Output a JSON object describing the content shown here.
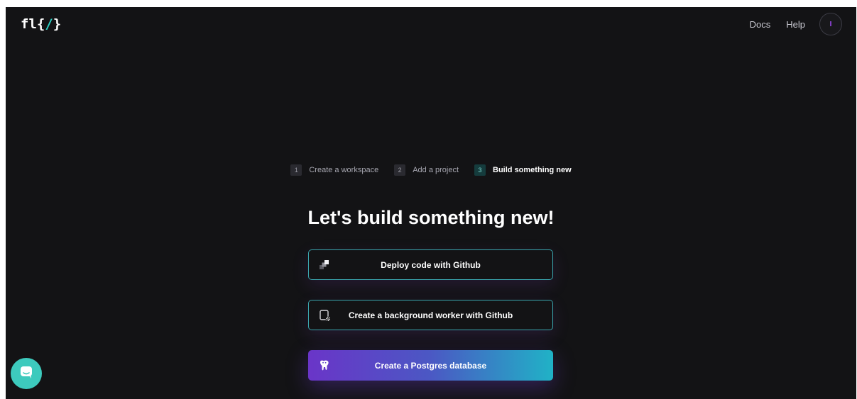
{
  "header": {
    "logo_left": "fl{",
    "logo_slash": "/",
    "logo_right": "}",
    "docs_label": "Docs",
    "help_label": "Help",
    "avatar_initial": "I"
  },
  "steps": [
    {
      "number": "1",
      "label": "Create a workspace",
      "active": false
    },
    {
      "number": "2",
      "label": "Add a project",
      "active": false
    },
    {
      "number": "3",
      "label": "Build something new",
      "active": true
    }
  ],
  "main": {
    "title": "Let's build something new!",
    "actions": [
      {
        "label": "Deploy code with Github",
        "icon": "layers-icon"
      },
      {
        "label": "Create a background worker with Github",
        "icon": "worker-gear-icon"
      },
      {
        "label": "Create a Postgres database",
        "icon": "postgres-elephant-icon"
      }
    ]
  },
  "chat": {
    "icon": "chat-bubble-icon"
  },
  "colors": {
    "background": "#131315",
    "accent_teal": "#2bd4c6",
    "accent_purple": "#6a35c8",
    "avatar_accent": "#a84dff"
  }
}
